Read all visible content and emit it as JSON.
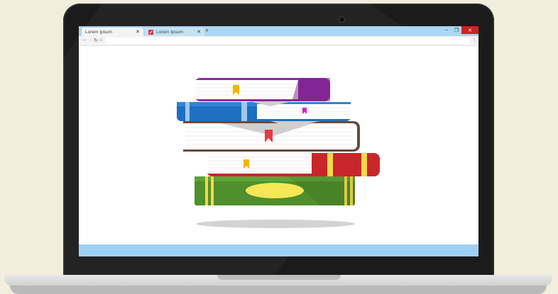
{
  "browser": {
    "tabs": [
      {
        "label": "Lorem Ipsum",
        "close": "✕"
      },
      {
        "label": "Lorem Ipsum",
        "close": "✕"
      }
    ],
    "new_tab": "+",
    "window": {
      "minimize": "–",
      "maximize": "❐",
      "close": "✕"
    },
    "nav": {
      "back": "←",
      "forward": "→",
      "reload": "↻",
      "home": "⌂",
      "menu": "⋮"
    }
  },
  "illustration": {
    "books": [
      {
        "cover": "#8e2aa0",
        "bookmark": "#f3b600"
      },
      {
        "cover": "#1f6fc1",
        "bookmark": "#d81ecf"
      },
      {
        "cover": "#6b4a3a",
        "bookmark": "#e53b43"
      },
      {
        "cover": "#c9262b",
        "bookmark": "#f3b600",
        "stripes": "#f3d84c"
      },
      {
        "cover": "#4f8f2c",
        "stripes": "#f3d84c"
      }
    ],
    "shadow": "#d3d3d3"
  },
  "colors": {
    "background": "#f1eedd",
    "bezel": "#1b1b1b",
    "tabbar": "#aad7f4",
    "statusbar": "#9fd0f3"
  }
}
